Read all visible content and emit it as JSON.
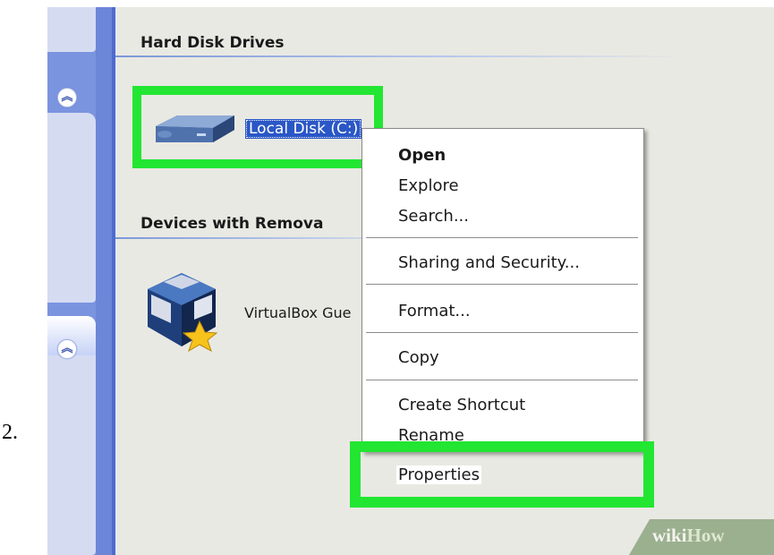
{
  "step": {
    "number": "2."
  },
  "groups": {
    "hard_disk_drives": "Hard Disk Drives",
    "removable_storage": "Devices with Remova"
  },
  "drives": [
    {
      "label": "Local Disk (C:)",
      "icon": "hard-drive-icon",
      "selected": true
    }
  ],
  "removable_devices": [
    {
      "label": "VirtualBox Gue",
      "icon": "virtualbox-icon"
    }
  ],
  "context_menu": {
    "items": [
      {
        "label": "Open",
        "bold": true
      },
      {
        "label": "Explore"
      },
      {
        "label": "Search..."
      },
      {
        "label": "Sharing and Security..."
      },
      {
        "label": "Format..."
      },
      {
        "label": "Copy"
      },
      {
        "label": "Create Shortcut"
      },
      {
        "label": "Rename"
      },
      {
        "label": "Properties",
        "highlighted": true
      }
    ]
  },
  "watermark": {
    "brand_part1": "wiki",
    "brand_part2": "How"
  },
  "colors": {
    "highlight_green": "#22e632",
    "selection_blue": "#2a57c6",
    "taskpane_blue": "#6c86d8"
  }
}
